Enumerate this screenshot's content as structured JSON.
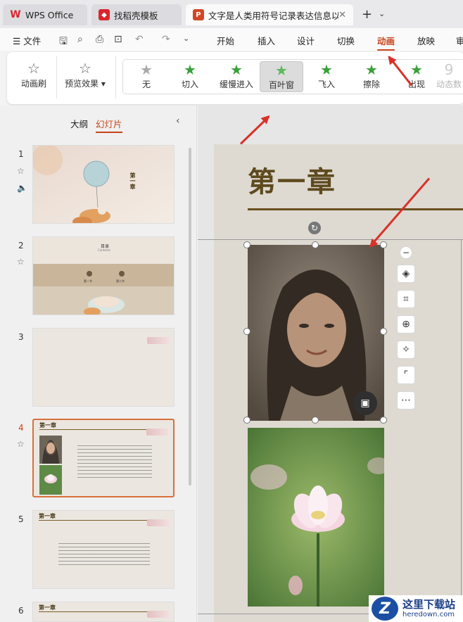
{
  "tabs": [
    {
      "label": "WPS Office"
    },
    {
      "label": "找稻壳模板"
    },
    {
      "label": "文字是人类用符号记录表达信息以"
    }
  ],
  "menu": {
    "file": "文件",
    "tabs": [
      "开始",
      "插入",
      "设计",
      "切换",
      "动画",
      "放映",
      "审"
    ],
    "active": "动画"
  },
  "ribbon": {
    "anim_brush": "动画刷",
    "preview": "预览效果",
    "effects": [
      "无",
      "切入",
      "缓慢进入",
      "百叶窗",
      "飞入",
      "擦除",
      "出现",
      "动态数"
    ],
    "selected_effect": "百叶窗"
  },
  "leftpanel": {
    "tab_outline": "大纲",
    "tab_slides": "幻灯片",
    "active_tab": "幻灯片",
    "slides": [
      {
        "num": "1"
      },
      {
        "num": "2",
        "thumb_title": "目录",
        "thumb_sub": "Contents",
        "thumb_items": [
          "第一节",
          "第二节"
        ]
      },
      {
        "num": "3"
      },
      {
        "num": "4",
        "thumb_title": "第一章"
      },
      {
        "num": "5",
        "thumb_title": "第一章"
      },
      {
        "num": "6",
        "thumb_title": "第一章"
      }
    ],
    "slide1_vertical": "第一章",
    "active_slide": "4"
  },
  "slide": {
    "title": "第一章"
  },
  "watermark": {
    "cn": "这里下载站",
    "en": "heredown.com",
    "logo": "Z"
  },
  "colors": {
    "accent": "#c8431a",
    "arrow": "#d8322a",
    "slide_title": "#5e4a1e"
  }
}
